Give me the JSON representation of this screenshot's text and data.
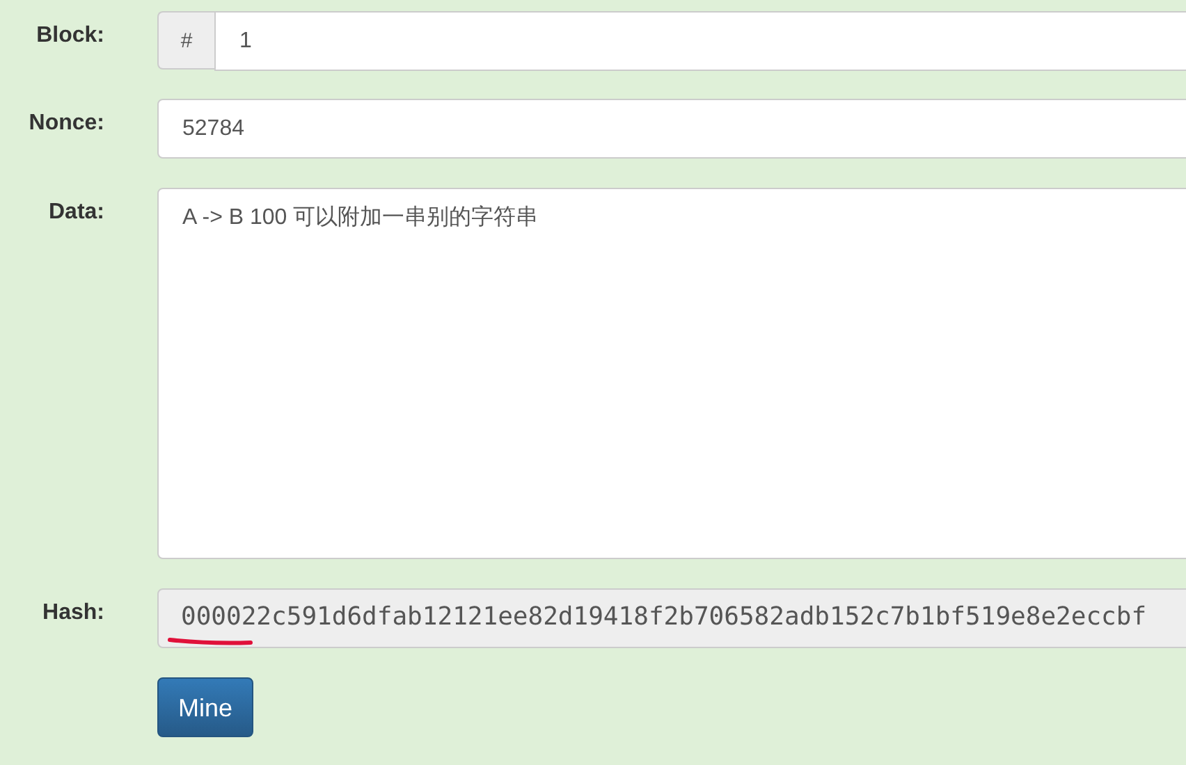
{
  "fields": [
    {
      "kind": "addon",
      "label": "Block:",
      "addon": "#",
      "value": "1"
    },
    {
      "kind": "text",
      "label": "Nonce:",
      "value": "52784"
    },
    {
      "kind": "area",
      "label": "Data:",
      "value": "A -> B 100   可以附加一串别的字符串"
    },
    {
      "kind": "hash",
      "label": "Hash:",
      "value": "000022c591d6dfab12121ee82d19418f2b706582adb152c7b1bf519e8e2eccbf"
    }
  ],
  "button": "Mine"
}
